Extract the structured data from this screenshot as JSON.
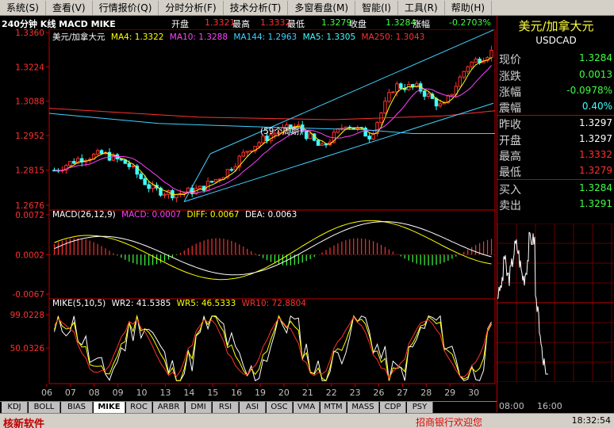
{
  "menu": [
    "系统(S)",
    "查看(V)",
    "行情报价(Q)",
    "分时分析(F)",
    "技术分析(T)",
    "多窗看盘(M)",
    "智能(I)",
    "工具(R)",
    "帮助(H)"
  ],
  "info": {
    "period": "240分钟 K线 MACD MIKE",
    "open_label": "开盘",
    "open_val": "1.3321",
    "high_label": "最高",
    "high_val": "1.3332",
    "low_label": "最低",
    "low_val": "1.3279",
    "close_label": "收盘",
    "close_val": "1.3284",
    "chg_label": "涨幅",
    "chg_val": "-0.2703%"
  },
  "ma_legend": {
    "name": "美元/加拿大元",
    "ma4": "MA4: 1.3322",
    "ma10": "MA10: 1.3288",
    "ma144": "MA144: 1.2963",
    "ma5": "MA5: 1.3305",
    "ma250": "MA250: 1.3043"
  },
  "macd_legend": {
    "params": "MACD(26,12,9)",
    "macd": "MACD: 0.0007",
    "diff": "DIFF: 0.0067",
    "dea": "DEA: 0.0063"
  },
  "mike_legend": {
    "params": "MIKE(5,10,5)",
    "wr2": "WR2: 41.5385",
    "wr5": "WR5: 46.5333",
    "wr10": "WR10: 72.8804"
  },
  "annotation": "(59个周期)",
  "dates": [
    "06",
    "07",
    "08",
    "09",
    "10",
    "13",
    "14",
    "15",
    "16",
    "19",
    "20",
    "21",
    "22",
    "23",
    "26",
    "27",
    "28",
    "29",
    "30"
  ],
  "panel": {
    "title": "美元/加拿大元",
    "code": "USDCAD",
    "rows": [
      {
        "label": "现价",
        "value": "1.3284",
        "color": "#40ff40"
      },
      {
        "label": "涨跌",
        "value": "0.0013",
        "color": "#40ff40"
      },
      {
        "label": "涨幅",
        "value": "-0.0978%",
        "color": "#40ff40"
      },
      {
        "label": "震幅",
        "value": "0.40%",
        "color": "#40ffff"
      },
      {
        "label": "昨收",
        "value": "1.3297",
        "color": "#ffffff"
      },
      {
        "label": "开盘",
        "value": "1.3297",
        "color": "#ffffff"
      },
      {
        "label": "最高",
        "value": "1.3332",
        "color": "#ff3030"
      },
      {
        "label": "最低",
        "value": "1.3279",
        "color": "#ff3030"
      },
      {
        "label": "买入",
        "value": "1.3284",
        "color": "#40ff40"
      },
      {
        "label": "卖出",
        "value": "1.3291",
        "color": "#40ff40"
      }
    ],
    "time_labels": [
      "08:00",
      "16:00"
    ]
  },
  "tabs": [
    "KDJ",
    "BOLL",
    "BIAS",
    "MIKE",
    "ROC",
    "ARBR",
    "DMI",
    "RSI",
    "ASI",
    "OSC",
    "VMA",
    "MTM",
    "MASS",
    "CDP",
    "PSY"
  ],
  "active_tab": "MIKE",
  "status": {
    "logo": "核新软件",
    "marquee": "招商银行欢迎您",
    "clock": "18:32:54"
  },
  "chart_data": [
    {
      "type": "candlestick",
      "title": "240分钟 K线",
      "ylim": [
        1.2676,
        1.336
      ],
      "yticks": [
        1.336,
        1.3224,
        1.3088,
        1.2952,
        1.2815,
        1.2676
      ],
      "x": [
        "06",
        "07",
        "08",
        "09",
        "10",
        "13",
        "14",
        "15",
        "16",
        "19",
        "20",
        "21",
        "22",
        "23",
        "26",
        "27",
        "28",
        "29",
        "30"
      ],
      "close": [
        1.2815,
        1.286,
        1.288,
        1.284,
        1.274,
        1.272,
        1.274,
        1.28,
        1.29,
        1.296,
        1.299,
        1.29,
        1.3,
        1.295,
        1.315,
        1.314,
        1.306,
        1.323,
        1.3284
      ]
    },
    {
      "type": "bar",
      "title": "MACD",
      "ylim": [
        -0.0067,
        0.0072
      ],
      "yticks": [
        0.0072,
        0.0002,
        -0.0067
      ]
    },
    {
      "type": "line",
      "title": "MIKE",
      "ylim": [
        0,
        99.0228
      ],
      "yticks": [
        99.0228,
        50.0326
      ]
    }
  ]
}
